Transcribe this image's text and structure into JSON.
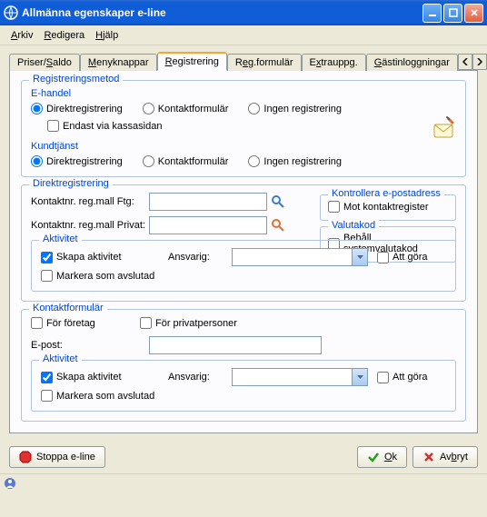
{
  "title": "Allmänna egenskaper e-line",
  "menu": {
    "arkiv": "Arkiv",
    "redigera": "Redigera",
    "hjalp": "Hjälp"
  },
  "tabs": {
    "priser": "Priser/Saldo",
    "menyknappar": "Menyknappar",
    "registrering": "Registrering",
    "regformular": "Reg.formulär",
    "extrauppg": "Extrauppg.",
    "gastinloggningar": "Gästinloggningar"
  },
  "panel": {
    "registreringsmetod": {
      "legend": "Registreringsmetod",
      "ehandel": {
        "legend": "E-handel",
        "direkt": "Direktregistrering",
        "kontakt": "Kontaktformulär",
        "ingen": "Ingen registrering",
        "endast": "Endast via kassasidan"
      },
      "kundtjanst": {
        "legend": "Kundtjänst",
        "direkt": "Direktregistrering",
        "kontakt": "Kontaktformulär",
        "ingen": "Ingen registrering"
      }
    },
    "direktreg": {
      "legend": "Direktregistrering",
      "mallFtg": "Kontaktnr. reg.mall Ftg:",
      "mallPrivat": "Kontaktnr. reg.mall Privat:",
      "kontrollera": {
        "legend": "Kontrollera e-postadress",
        "mot": "Mot kontaktregister"
      },
      "valutakod": {
        "legend": "Valutakod",
        "behall": "Behåll systemvalutakod"
      },
      "aktivitet": {
        "legend": "Aktivitet",
        "skapa": "Skapa aktivitet",
        "markera": "Markera som avslutad",
        "ansvarig": "Ansvarig:",
        "attgora": "Att göra"
      }
    },
    "kontaktformular": {
      "legend": "Kontaktformulär",
      "foretag": "För företag",
      "privat": "För privatpersoner",
      "epost": "E-post:",
      "aktivitet": {
        "legend": "Aktivitet",
        "skapa": "Skapa aktivitet",
        "markera": "Markera som avslutad",
        "ansvarig": "Ansvarig:",
        "attgora": "Att göra"
      }
    }
  },
  "buttons": {
    "stoppa": "Stoppa e-line",
    "ok": "Ok",
    "avbryt": "Avbryt"
  }
}
